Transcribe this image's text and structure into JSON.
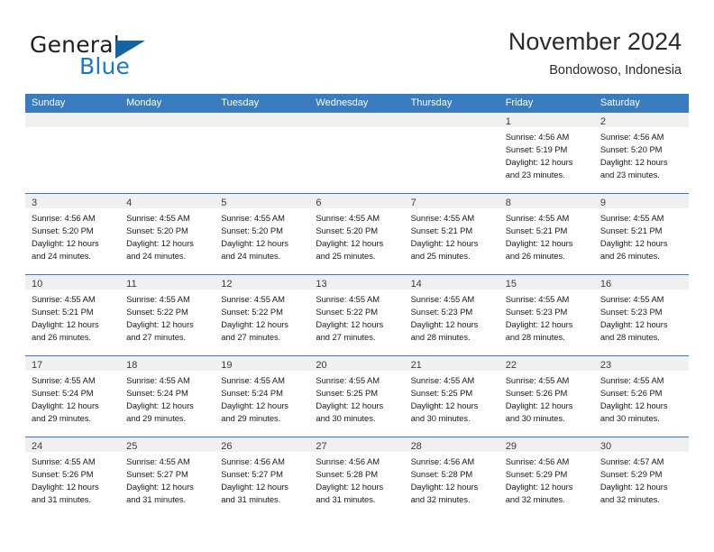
{
  "brand": {
    "name_part1": "General",
    "name_part2": "Blue",
    "logo_icon": "triangle-logo-icon",
    "accent_color": "#1c79c0"
  },
  "header": {
    "month_title": "November 2024",
    "location": "Bondowoso, Indonesia"
  },
  "theme": {
    "header_row_bg": "#3a7cc0",
    "day_band_bg": "#f0f0f0",
    "row_divider": "#3a7cc0"
  },
  "weekdays": [
    "Sunday",
    "Monday",
    "Tuesday",
    "Wednesday",
    "Thursday",
    "Friday",
    "Saturday"
  ],
  "weeks": [
    [
      {
        "day": "",
        "lines": []
      },
      {
        "day": "",
        "lines": []
      },
      {
        "day": "",
        "lines": []
      },
      {
        "day": "",
        "lines": []
      },
      {
        "day": "",
        "lines": []
      },
      {
        "day": "1",
        "lines": [
          "Sunrise: 4:56 AM",
          "Sunset: 5:19 PM",
          "Daylight: 12 hours",
          "and 23 minutes."
        ]
      },
      {
        "day": "2",
        "lines": [
          "Sunrise: 4:56 AM",
          "Sunset: 5:20 PM",
          "Daylight: 12 hours",
          "and 23 minutes."
        ]
      }
    ],
    [
      {
        "day": "3",
        "lines": [
          "Sunrise: 4:56 AM",
          "Sunset: 5:20 PM",
          "Daylight: 12 hours",
          "and 24 minutes."
        ]
      },
      {
        "day": "4",
        "lines": [
          "Sunrise: 4:55 AM",
          "Sunset: 5:20 PM",
          "Daylight: 12 hours",
          "and 24 minutes."
        ]
      },
      {
        "day": "5",
        "lines": [
          "Sunrise: 4:55 AM",
          "Sunset: 5:20 PM",
          "Daylight: 12 hours",
          "and 24 minutes."
        ]
      },
      {
        "day": "6",
        "lines": [
          "Sunrise: 4:55 AM",
          "Sunset: 5:20 PM",
          "Daylight: 12 hours",
          "and 25 minutes."
        ]
      },
      {
        "day": "7",
        "lines": [
          "Sunrise: 4:55 AM",
          "Sunset: 5:21 PM",
          "Daylight: 12 hours",
          "and 25 minutes."
        ]
      },
      {
        "day": "8",
        "lines": [
          "Sunrise: 4:55 AM",
          "Sunset: 5:21 PM",
          "Daylight: 12 hours",
          "and 26 minutes."
        ]
      },
      {
        "day": "9",
        "lines": [
          "Sunrise: 4:55 AM",
          "Sunset: 5:21 PM",
          "Daylight: 12 hours",
          "and 26 minutes."
        ]
      }
    ],
    [
      {
        "day": "10",
        "lines": [
          "Sunrise: 4:55 AM",
          "Sunset: 5:21 PM",
          "Daylight: 12 hours",
          "and 26 minutes."
        ]
      },
      {
        "day": "11",
        "lines": [
          "Sunrise: 4:55 AM",
          "Sunset: 5:22 PM",
          "Daylight: 12 hours",
          "and 27 minutes."
        ]
      },
      {
        "day": "12",
        "lines": [
          "Sunrise: 4:55 AM",
          "Sunset: 5:22 PM",
          "Daylight: 12 hours",
          "and 27 minutes."
        ]
      },
      {
        "day": "13",
        "lines": [
          "Sunrise: 4:55 AM",
          "Sunset: 5:22 PM",
          "Daylight: 12 hours",
          "and 27 minutes."
        ]
      },
      {
        "day": "14",
        "lines": [
          "Sunrise: 4:55 AM",
          "Sunset: 5:23 PM",
          "Daylight: 12 hours",
          "and 28 minutes."
        ]
      },
      {
        "day": "15",
        "lines": [
          "Sunrise: 4:55 AM",
          "Sunset: 5:23 PM",
          "Daylight: 12 hours",
          "and 28 minutes."
        ]
      },
      {
        "day": "16",
        "lines": [
          "Sunrise: 4:55 AM",
          "Sunset: 5:23 PM",
          "Daylight: 12 hours",
          "and 28 minutes."
        ]
      }
    ],
    [
      {
        "day": "17",
        "lines": [
          "Sunrise: 4:55 AM",
          "Sunset: 5:24 PM",
          "Daylight: 12 hours",
          "and 29 minutes."
        ]
      },
      {
        "day": "18",
        "lines": [
          "Sunrise: 4:55 AM",
          "Sunset: 5:24 PM",
          "Daylight: 12 hours",
          "and 29 minutes."
        ]
      },
      {
        "day": "19",
        "lines": [
          "Sunrise: 4:55 AM",
          "Sunset: 5:24 PM",
          "Daylight: 12 hours",
          "and 29 minutes."
        ]
      },
      {
        "day": "20",
        "lines": [
          "Sunrise: 4:55 AM",
          "Sunset: 5:25 PM",
          "Daylight: 12 hours",
          "and 30 minutes."
        ]
      },
      {
        "day": "21",
        "lines": [
          "Sunrise: 4:55 AM",
          "Sunset: 5:25 PM",
          "Daylight: 12 hours",
          "and 30 minutes."
        ]
      },
      {
        "day": "22",
        "lines": [
          "Sunrise: 4:55 AM",
          "Sunset: 5:26 PM",
          "Daylight: 12 hours",
          "and 30 minutes."
        ]
      },
      {
        "day": "23",
        "lines": [
          "Sunrise: 4:55 AM",
          "Sunset: 5:26 PM",
          "Daylight: 12 hours",
          "and 30 minutes."
        ]
      }
    ],
    [
      {
        "day": "24",
        "lines": [
          "Sunrise: 4:55 AM",
          "Sunset: 5:26 PM",
          "Daylight: 12 hours",
          "and 31 minutes."
        ]
      },
      {
        "day": "25",
        "lines": [
          "Sunrise: 4:55 AM",
          "Sunset: 5:27 PM",
          "Daylight: 12 hours",
          "and 31 minutes."
        ]
      },
      {
        "day": "26",
        "lines": [
          "Sunrise: 4:56 AM",
          "Sunset: 5:27 PM",
          "Daylight: 12 hours",
          "and 31 minutes."
        ]
      },
      {
        "day": "27",
        "lines": [
          "Sunrise: 4:56 AM",
          "Sunset: 5:28 PM",
          "Daylight: 12 hours",
          "and 31 minutes."
        ]
      },
      {
        "day": "28",
        "lines": [
          "Sunrise: 4:56 AM",
          "Sunset: 5:28 PM",
          "Daylight: 12 hours",
          "and 32 minutes."
        ]
      },
      {
        "day": "29",
        "lines": [
          "Sunrise: 4:56 AM",
          "Sunset: 5:29 PM",
          "Daylight: 12 hours",
          "and 32 minutes."
        ]
      },
      {
        "day": "30",
        "lines": [
          "Sunrise: 4:57 AM",
          "Sunset: 5:29 PM",
          "Daylight: 12 hours",
          "and 32 minutes."
        ]
      }
    ]
  ]
}
